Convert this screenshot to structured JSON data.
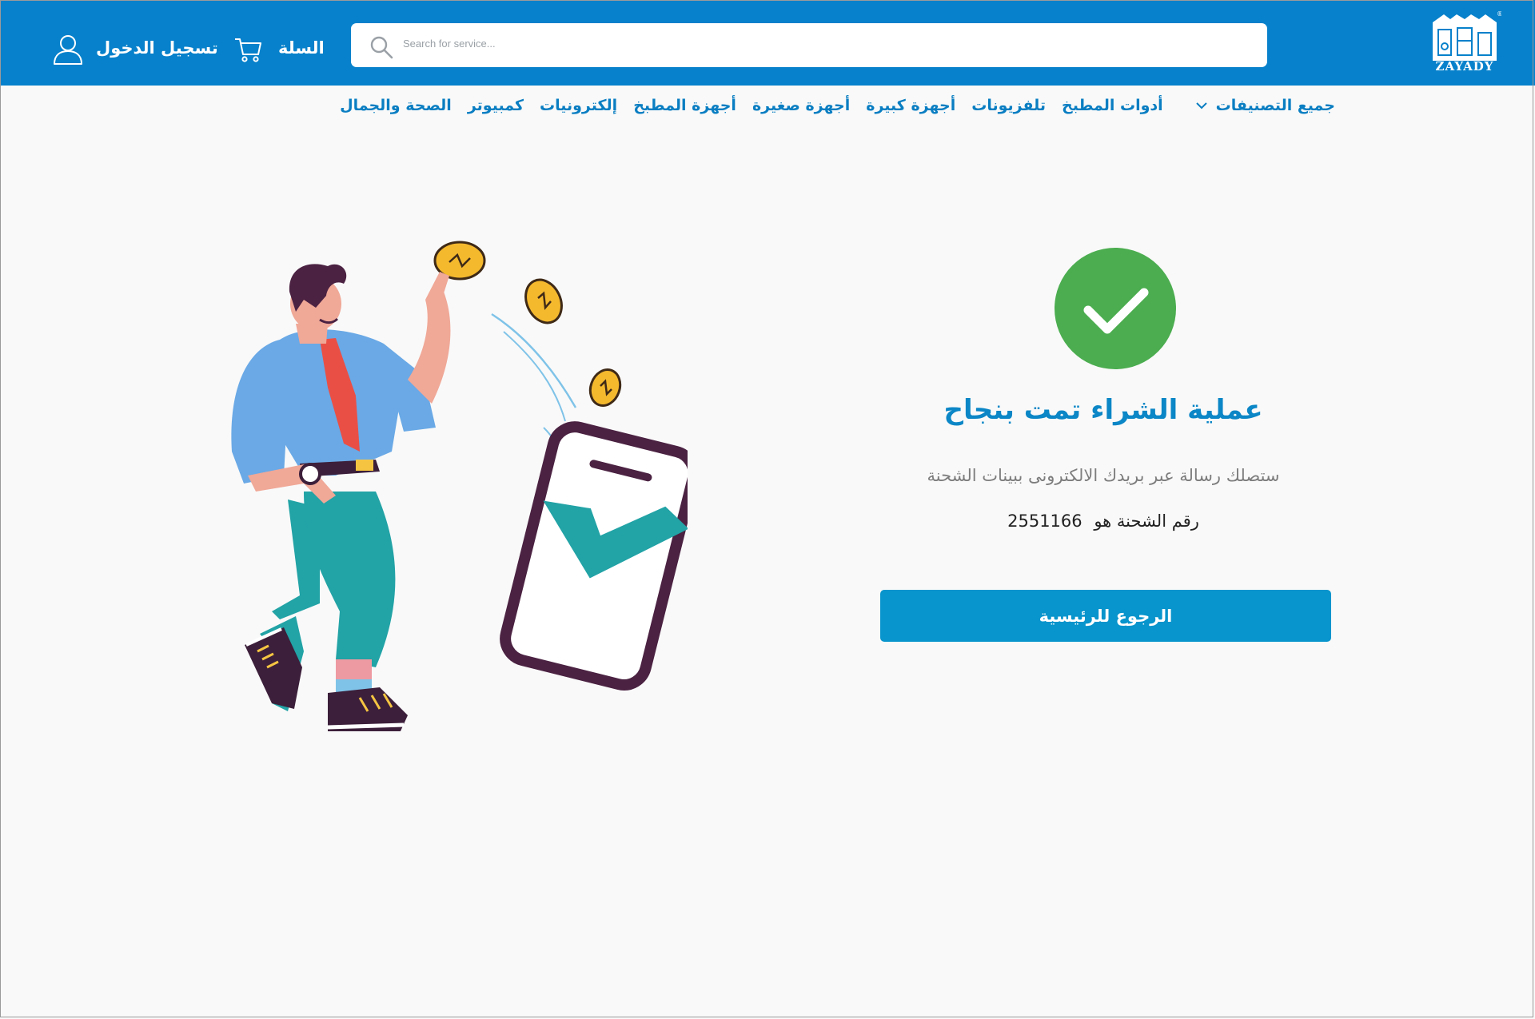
{
  "brand": {
    "name": "ZAYADY",
    "color": "#0781cb",
    "accent": "#0894cc",
    "success": "#4bad4f"
  },
  "header": {
    "search_placeholder": "Search for service...",
    "cart_label": "السلة",
    "login_label": "تسجيل الدخول"
  },
  "categories": {
    "all_label": "جميع التصنيفات",
    "items": [
      "أدوات المطبخ",
      "تلفزيونات",
      "أجهزة كبيرة",
      "أجهزة صغيرة",
      "أجهزة المطبخ",
      "إلكترونيات",
      "كمبيوتر",
      "الصحة والجمال"
    ]
  },
  "success": {
    "title": "عملية الشراء تمت بنجاح",
    "subtitle": "ستصلك رسالة عبر بريدك الالكترونى ببينات الشحنة",
    "shipment_label": "رقم الشحنة هو",
    "shipment_number": "2551166",
    "home_button": "الرجوع للرئيسية"
  },
  "icons": [
    "logo-icon",
    "search-icon",
    "cart-icon",
    "user-icon",
    "chevron-down-icon",
    "check-icon"
  ]
}
